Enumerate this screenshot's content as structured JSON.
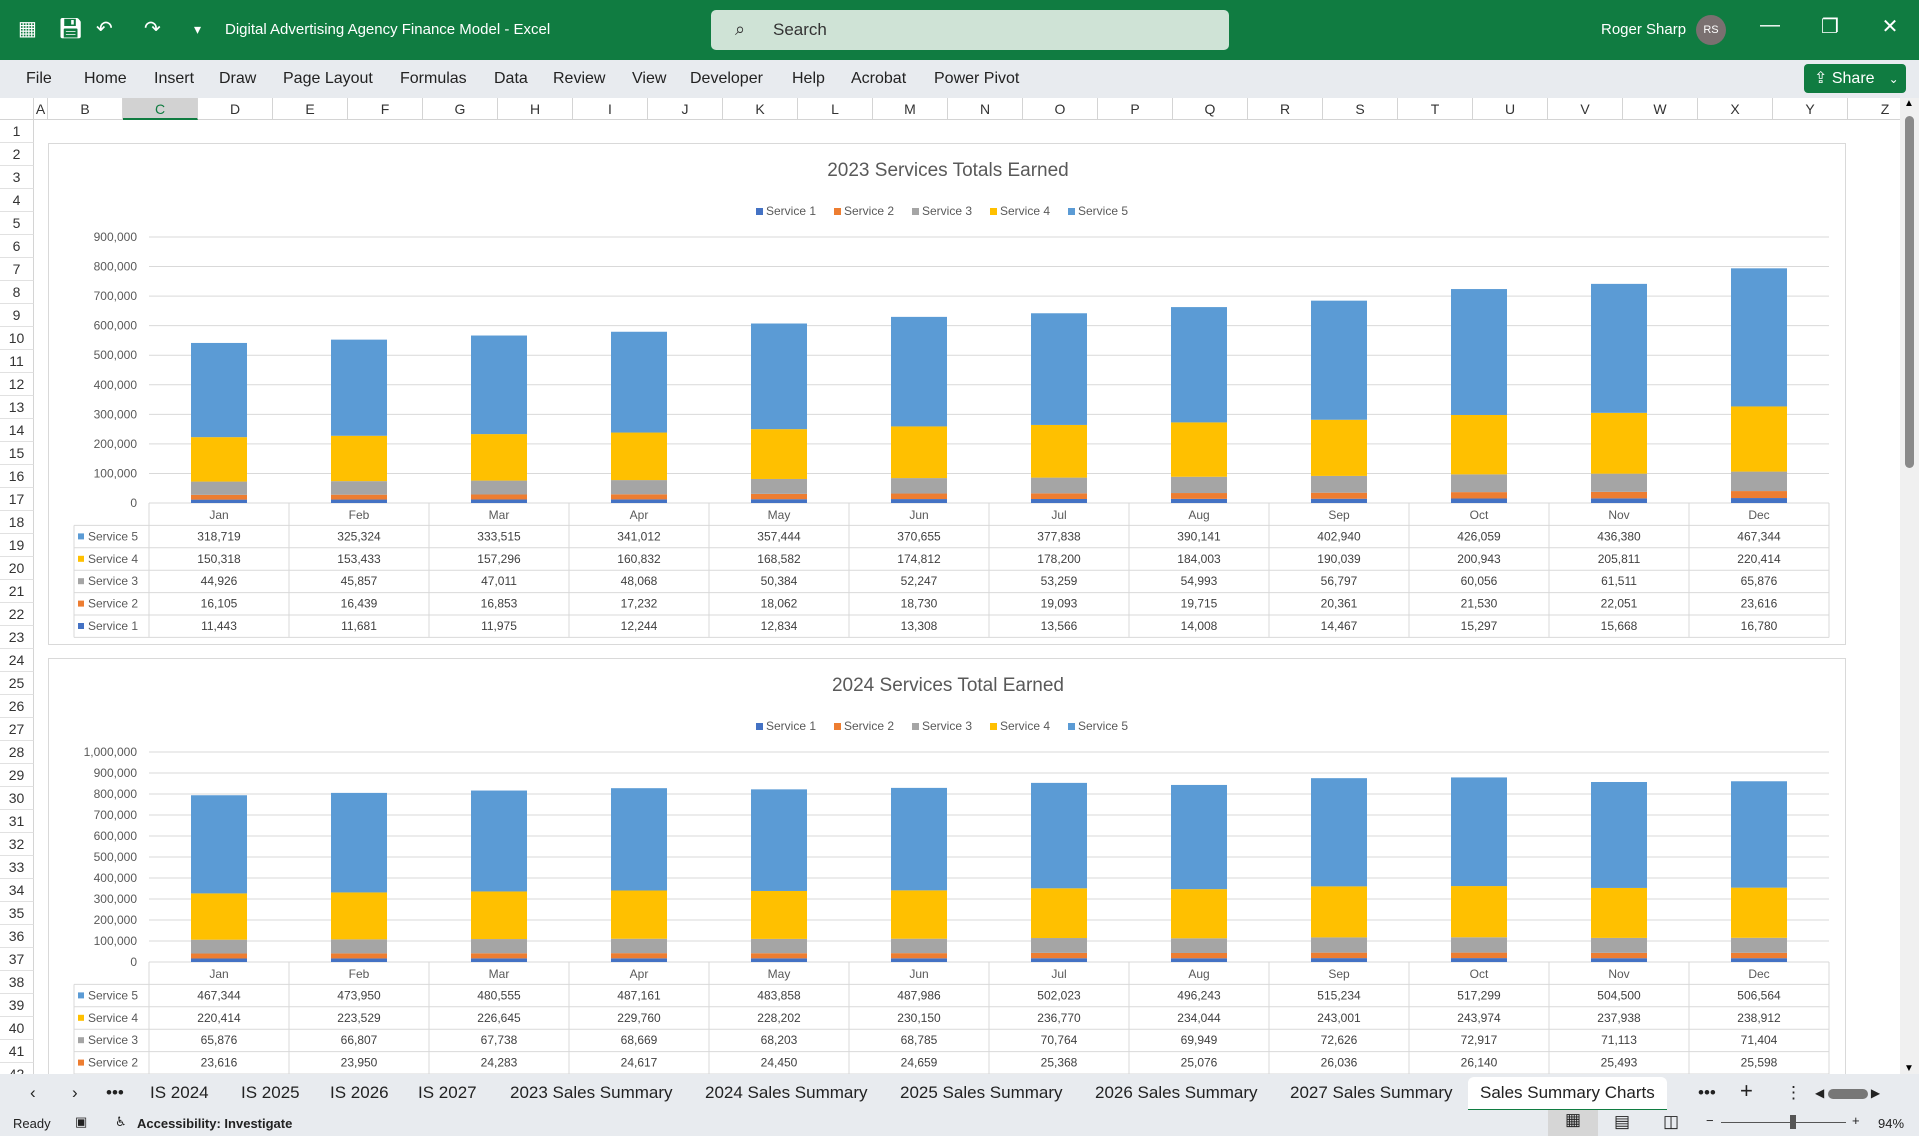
{
  "titlebar": {
    "title": "Digital Advertising Agency Finance Model  -  Excel",
    "search_placeholder": "Search",
    "user": "Roger Sharp",
    "initials": "RS"
  },
  "ribbon": {
    "tabs": [
      "File",
      "Home",
      "Insert",
      "Draw",
      "Page Layout",
      "Formulas",
      "Data",
      "Review",
      "View",
      "Developer",
      "Help",
      "Acrobat",
      "Power Pivot"
    ],
    "share": "Share"
  },
  "columns": [
    "A",
    "B",
    "C",
    "D",
    "E",
    "F",
    "G",
    "H",
    "I",
    "J",
    "K",
    "L",
    "M",
    "N",
    "O",
    "P",
    "Q",
    "R",
    "S",
    "T",
    "U",
    "V",
    "W",
    "X",
    "Y",
    "Z"
  ],
  "selected_column": "C",
  "rows": [
    "1",
    "2",
    "3",
    "4",
    "5",
    "6",
    "7",
    "8",
    "9",
    "10",
    "11",
    "12",
    "13",
    "14",
    "15",
    "16",
    "17",
    "18",
    "19",
    "20",
    "21",
    "22",
    "23",
    "24",
    "25",
    "26",
    "27",
    "28",
    "29",
    "30",
    "31",
    "32",
    "33",
    "34",
    "35",
    "36",
    "37",
    "38",
    "39",
    "40",
    "41",
    "42"
  ],
  "sheet_tabs": [
    "IS 2024",
    "IS 2025",
    "IS 2026",
    "IS 2027",
    "2023 Sales Summary",
    "2024 Sales Summary",
    "2025 Sales Summary",
    "2026 Sales Summary",
    "2027 Sales Summary",
    "Sales Summary Charts"
  ],
  "active_sheet": "Sales Summary Charts",
  "status": {
    "ready": "Ready",
    "accessibility": "Accessibility: Investigate",
    "zoom": "94%",
    "zoom_level": 0.94
  },
  "chart_data": [
    {
      "type": "bar",
      "stacked": true,
      "title": "2023 Services Totals Earned",
      "legend": "top",
      "ylim": [
        0,
        900000
      ],
      "ystep": 100000,
      "yticks": [
        "0",
        "100,000",
        "200,000",
        "300,000",
        "400,000",
        "500,000",
        "600,000",
        "700,000",
        "800,000",
        "900,000"
      ],
      "categories": [
        "Jan",
        "Feb",
        "Mar",
        "Apr",
        "May",
        "Jun",
        "Jul",
        "Aug",
        "Sep",
        "Oct",
        "Nov",
        "Dec"
      ],
      "series": [
        {
          "name": "Service 1",
          "color": "#4472c4",
          "values": [
            11443,
            11681,
            11975,
            12244,
            12834,
            13308,
            13566,
            14008,
            14467,
            15297,
            15668,
            16780
          ],
          "labels": [
            "11,443",
            "11,681",
            "11,975",
            "12,244",
            "12,834",
            "13,308",
            "13,566",
            "14,008",
            "14,467",
            "15,297",
            "15,668",
            "16,780"
          ]
        },
        {
          "name": "Service 2",
          "color": "#ed7d31",
          "values": [
            16105,
            16439,
            16853,
            17232,
            18062,
            18730,
            19093,
            19715,
            20361,
            21530,
            22051,
            23616
          ],
          "labels": [
            "16,105",
            "16,439",
            "16,853",
            "17,232",
            "18,062",
            "18,730",
            "19,093",
            "19,715",
            "20,361",
            "21,530",
            "22,051",
            "23,616"
          ]
        },
        {
          "name": "Service 3",
          "color": "#a5a5a5",
          "values": [
            44926,
            45857,
            47011,
            48068,
            50384,
            52247,
            53259,
            54993,
            56797,
            60056,
            61511,
            65876
          ],
          "labels": [
            "44,926",
            "45,857",
            "47,011",
            "48,068",
            "50,384",
            "52,247",
            "53,259",
            "54,993",
            "56,797",
            "60,056",
            "61,511",
            "65,876"
          ]
        },
        {
          "name": "Service 4",
          "color": "#ffc000",
          "values": [
            150318,
            153433,
            157296,
            160832,
            168582,
            174812,
            178200,
            184003,
            190039,
            200943,
            205811,
            220414
          ],
          "labels": [
            "150,318",
            "153,433",
            "157,296",
            "160,832",
            "168,582",
            "174,812",
            "178,200",
            "184,003",
            "190,039",
            "200,943",
            "205,811",
            "220,414"
          ]
        },
        {
          "name": "Service 5",
          "color": "#5b9bd5",
          "values": [
            318719,
            325324,
            333515,
            341012,
            357444,
            370655,
            377838,
            390141,
            402940,
            426059,
            436380,
            467344
          ],
          "labels": [
            "318,719",
            "325,324",
            "333,515",
            "341,012",
            "357,444",
            "370,655",
            "377,838",
            "390,141",
            "402,940",
            "426,059",
            "436,380",
            "467,344"
          ]
        }
      ]
    },
    {
      "type": "bar",
      "stacked": true,
      "title": "2024 Services Total Earned",
      "legend": "top",
      "ylim": [
        0,
        1000000
      ],
      "ystep": 100000,
      "yticks": [
        "0",
        "100,000",
        "200,000",
        "300,000",
        "400,000",
        "500,000",
        "600,000",
        "700,000",
        "800,000",
        "900,000",
        "1,000,000"
      ],
      "categories": [
        "Jan",
        "Feb",
        "Mar",
        "Apr",
        "May",
        "Jun",
        "Jul",
        "Aug",
        "Sep",
        "Oct",
        "Nov",
        "Dec"
      ],
      "series": [
        {
          "name": "Service 1",
          "color": "#4472c4",
          "values": [
            16780,
            17017,
            17253,
            17490,
            17372,
            17520,
            18024,
            17816,
            18498,
            18572,
            18112,
            18187
          ]
        },
        {
          "name": "Service 2",
          "color": "#ed7d31",
          "values": [
            23616,
            23950,
            24283,
            24617,
            24450,
            24659,
            25368,
            25076,
            26036,
            26140,
            25493,
            25598
          ],
          "labels": [
            "23,616",
            "23,950",
            "24,283",
            "24,617",
            "24,450",
            "24,659",
            "25,368",
            "25,076",
            "26,036",
            "26,140",
            "25,493",
            "25,598"
          ]
        },
        {
          "name": "Service 3",
          "color": "#a5a5a5",
          "values": [
            65876,
            66807,
            67738,
            68669,
            68203,
            68785,
            70764,
            69949,
            72626,
            72917,
            71113,
            71404
          ],
          "labels": [
            "65,876",
            "66,807",
            "67,738",
            "68,669",
            "68,203",
            "68,785",
            "70,764",
            "69,949",
            "72,626",
            "72,917",
            "71,113",
            "71,404"
          ]
        },
        {
          "name": "Service 4",
          "color": "#ffc000",
          "values": [
            220414,
            223529,
            226645,
            229760,
            228202,
            230150,
            236770,
            234044,
            243001,
            243974,
            237938,
            238912
          ],
          "labels": [
            "220,414",
            "223,529",
            "226,645",
            "229,760",
            "228,202",
            "230,150",
            "236,770",
            "234,044",
            "243,001",
            "243,974",
            "237,938",
            "238,912"
          ]
        },
        {
          "name": "Service 5",
          "color": "#5b9bd5",
          "values": [
            467344,
            473950,
            480555,
            487161,
            483858,
            487986,
            502023,
            496243,
            515234,
            517299,
            504500,
            506564
          ],
          "labels": [
            "467,344",
            "473,950",
            "480,555",
            "487,161",
            "483,858",
            "487,986",
            "502,023",
            "496,243",
            "515,234",
            "517,299",
            "504,500",
            "506,564"
          ]
        }
      ]
    }
  ]
}
